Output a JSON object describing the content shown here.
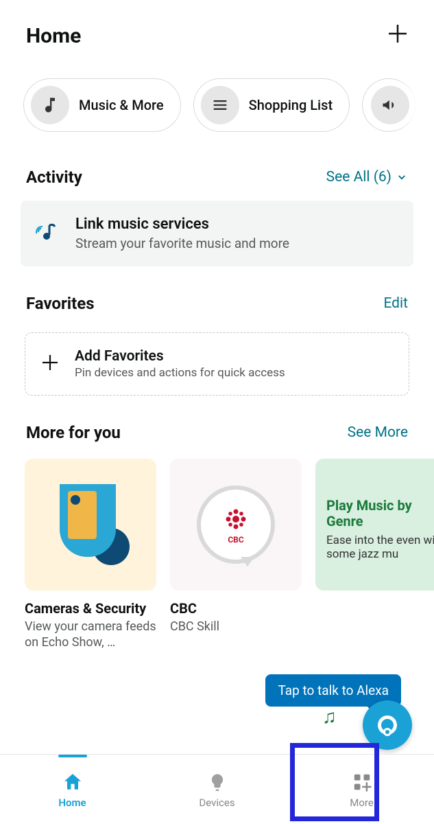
{
  "header": {
    "title": "Home"
  },
  "shortcuts": [
    {
      "label": "Music & More"
    },
    {
      "label": "Shopping List"
    }
  ],
  "activity": {
    "heading": "Activity",
    "see_all": "See All (6)",
    "card": {
      "title": "Link music services",
      "subtitle": "Stream your favorite music and more"
    }
  },
  "favorites": {
    "heading": "Favorites",
    "edit": "Edit",
    "add": {
      "title": "Add Favorites",
      "subtitle": "Pin devices and actions for quick access"
    }
  },
  "more": {
    "heading": "More for you",
    "see_more": "See More",
    "cards": [
      {
        "title": "Cameras & Security",
        "subtitle": "View your camera feeds on Echo Show, …"
      },
      {
        "title": "CBC",
        "subtitle": "CBC Skill",
        "badge": "CBC"
      },
      {
        "title": "Play Music by Genre",
        "subtitle": "Ease into the even with some jazz mu"
      }
    ]
  },
  "tooltip": "Tap to talk to Alexa",
  "nav": {
    "home": "Home",
    "devices": "Devices",
    "more": "More"
  }
}
